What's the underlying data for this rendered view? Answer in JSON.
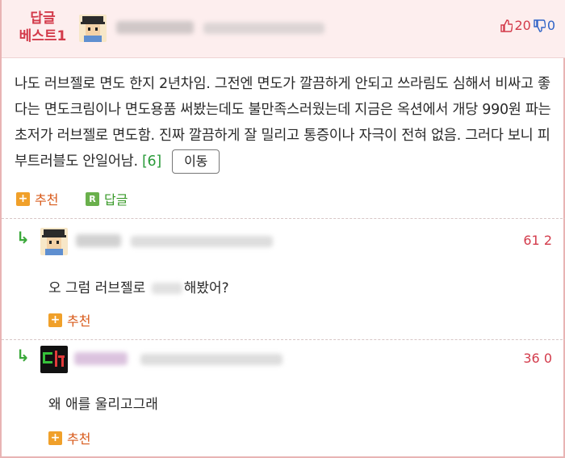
{
  "best": {
    "label_line1": "답글",
    "label_line2": "베스트1",
    "upvotes": "20",
    "downvotes": "0",
    "body_text": "나도 러브젤로 면도 한지 2년차임. 그전엔 면도가 깔끔하게 안되고 쓰라림도 심해서 비싸고 좋다는 면도크림이나 면도용품 써봤는데도 불만족스러웠는데 지금은 옥션에서 개당 990원 파는 초저가 러브젤로 면도함. 진짜 깔끔하게 잘 밀리고 통증이나 자극이 전혀 없음. 그러다 보니 피부트러블도 안일어남.",
    "reply_count": "[6]",
    "move_button": "이동",
    "recommend_label": "추천",
    "reply_label": "답글"
  },
  "replies": [
    {
      "text_before": "오 그럼 러브젤로 ",
      "text_after": "해봤어?",
      "votes": "61 2",
      "recommend_label": "추천"
    },
    {
      "text": "왜 애를 울리고그래",
      "votes": "36 0",
      "recommend_label": "추천"
    }
  ],
  "colors": {
    "accent": "#d33b4b",
    "header_bg": "#fdeeee",
    "reply_arrow": "#3aa83a",
    "recommend_icon": "#f0a02a"
  },
  "icons": {
    "up": "thumbs-up-icon",
    "down": "thumbs-down-icon",
    "reply_arrow": "reply-arrow-icon",
    "plus": "plus-icon",
    "reply": "reply-icon"
  }
}
